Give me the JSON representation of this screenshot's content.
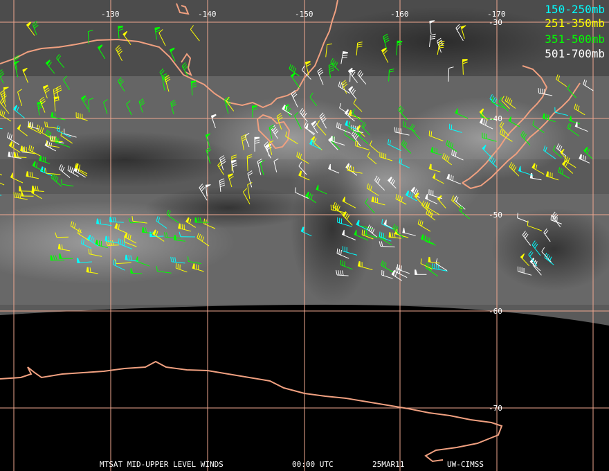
{
  "legend": [
    {
      "label": "150-250mb",
      "color": "#00ffff"
    },
    {
      "label": "251-350mb",
      "color": "#ffff00"
    },
    {
      "label": "351-500mb",
      "color": "#00ff00"
    },
    {
      "label": "501-700mb",
      "color": "#ffffff"
    }
  ],
  "grid": {
    "longitudes": [
      "-130",
      "-140",
      "-150",
      "-160",
      "-170"
    ],
    "latitudes": [
      "-30",
      "-40",
      "-50",
      "-60",
      "-70"
    ],
    "line_color": "#f0a890"
  },
  "coastline_color": "#f0a080",
  "footer": {
    "product": "MTSAT MID-UPPER LEVEL WINDS",
    "time": "00:00 UTC",
    "date": "25MAR11",
    "source": "UW-CIMSS"
  }
}
